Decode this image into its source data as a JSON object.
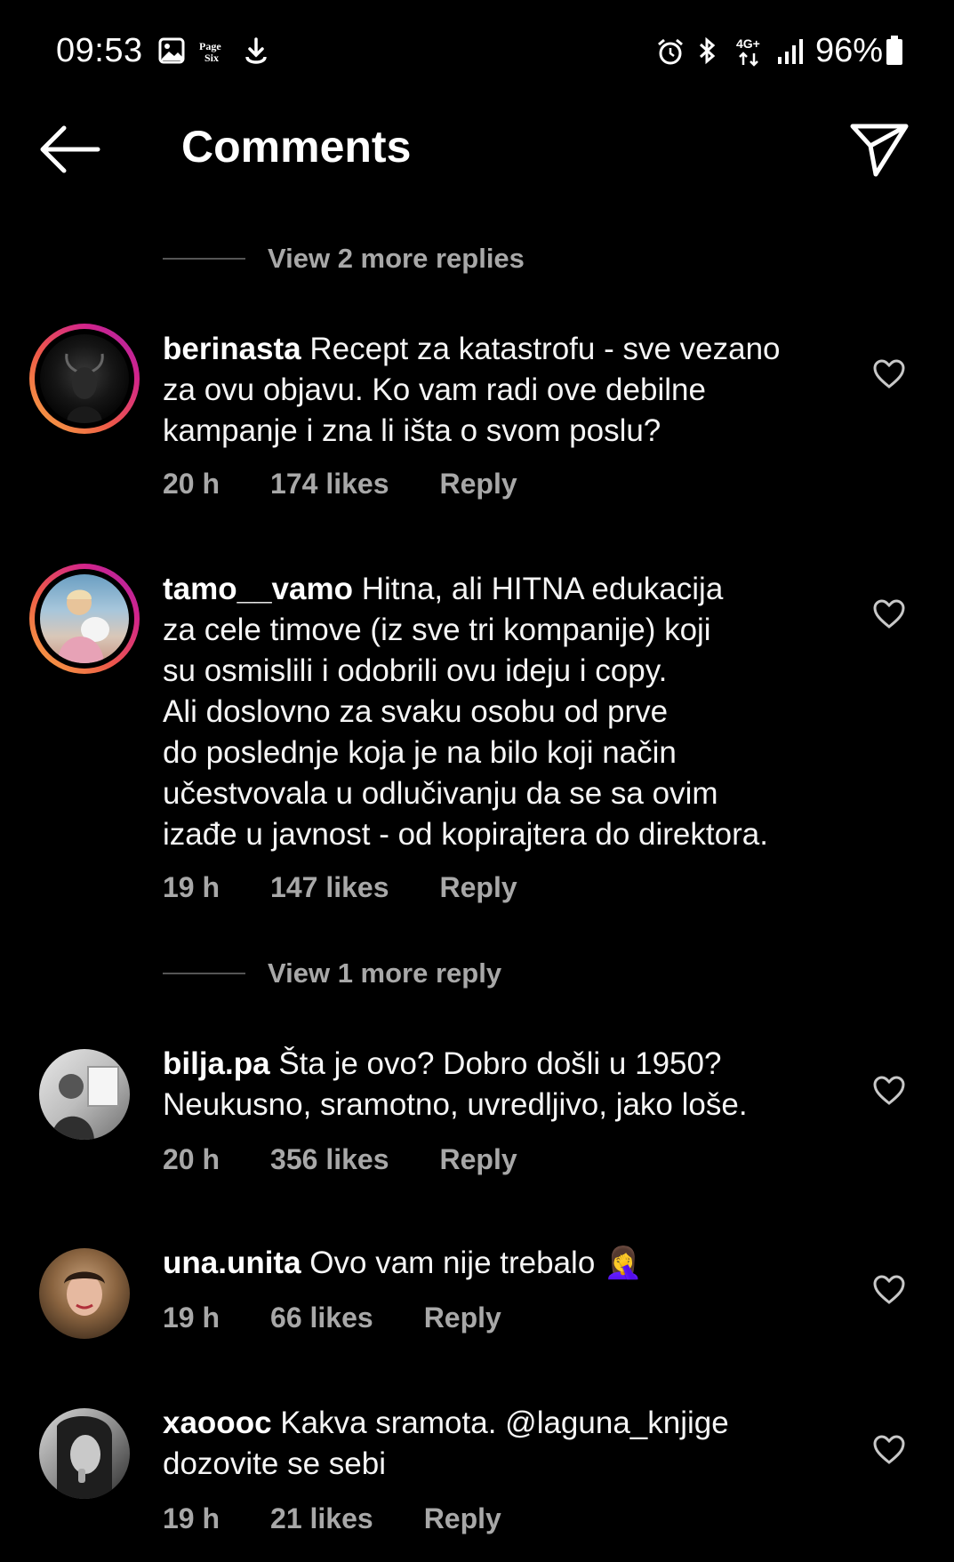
{
  "status_bar": {
    "time": "09:53",
    "notification_icons": [
      "gallery-icon",
      "page-six-icon",
      "download-icon"
    ],
    "system_icons": [
      "alarm-icon",
      "bluetooth-icon",
      "4g-icon",
      "signal-icon"
    ],
    "battery": "96%"
  },
  "header": {
    "title": "Comments"
  },
  "view_more_1": "View 2 more replies",
  "view_more_2": "View 1 more reply",
  "comments": [
    {
      "username": "berinasta",
      "lines": [
        "Recept za katastrofu - sve vezano",
        "za ovu objavu. Ko vam radi ove debilne",
        "kampanje i zna li išta o svom poslu?"
      ],
      "time": "20 h",
      "likes": "174 likes",
      "reply": "Reply"
    },
    {
      "username": "tamo__vamo",
      "lines": [
        "Hitna, ali HITNA edukacija",
        "za cele timove (iz sve tri kompanije) koji",
        "su osmislili i odobrili ovu ideju i copy.",
        "Ali doslovno za svaku osobu od prve",
        "do poslednje koja je na bilo koji način",
        "učestvovala u odlučivanju da se sa ovim",
        "izađe u javnost - od kopirajtera do direktora."
      ],
      "time": "19 h",
      "likes": "147 likes",
      "reply": "Reply"
    },
    {
      "username": "bilja.pa",
      "lines": [
        "Šta je ovo? Dobro došli u 1950?",
        "Neukusno, sramotno, uvredljivo, jako loše."
      ],
      "time": "20 h",
      "likes": "356 likes",
      "reply": "Reply"
    },
    {
      "username": "una.unita",
      "lines": [
        "Ovo vam nije trebalo"
      ],
      "emoji": "🤦‍♀️",
      "time": "19 h",
      "likes": "66 likes",
      "reply": "Reply"
    },
    {
      "username": "xaoooc",
      "lines": [
        "Kakva sramota. @laguna_knjige",
        "dozovite se sebi"
      ],
      "time": "19 h",
      "likes": "21 likes",
      "reply": "Reply"
    }
  ]
}
